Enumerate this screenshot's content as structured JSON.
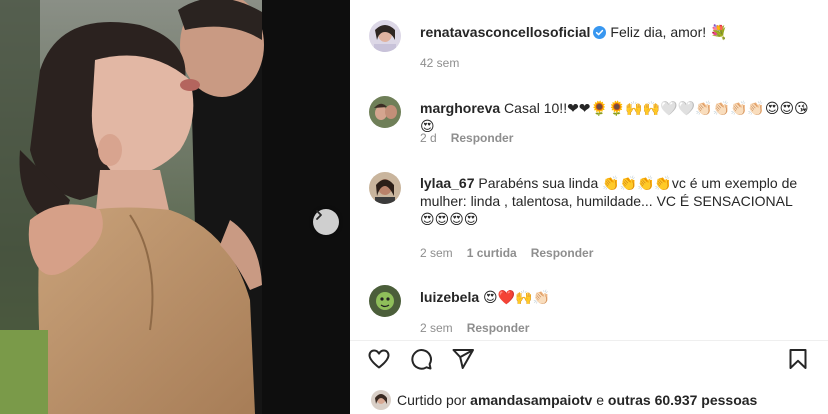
{
  "post": {
    "author": "renatavasconcellosoficial",
    "caption": "Feliz dia, amor! 💐",
    "time": "42 sem"
  },
  "comments": [
    {
      "user": "marghoreva",
      "text": "Casal 10!!❤❤🌻🌻🙌🙌🤍🤍👏🏻👏🏻👏🏻👏🏻😍😍😘😍",
      "time": "2 d",
      "reply": "Responder"
    },
    {
      "user": "lylaa_67",
      "text_line1": "Parabéns sua linda 👏👏👏👏vc é um exemplo de",
      "text_line2": "mulher: linda , talentosa, humildade... VC É SENSACIONAL",
      "text_line3": "😍😍😍😍",
      "time": "2 sem",
      "likes": "1 curtida",
      "reply": "Responder"
    },
    {
      "user": "luizebela",
      "text": "😍❤️🙌👏🏻",
      "time": "2 sem",
      "reply": "Responder"
    }
  ],
  "footer": {
    "liked_prefix": "Curtido por",
    "liked_user": "amandasampaiotv",
    "liked_middle": "e",
    "liked_others": "outras 60.937 pessoas"
  },
  "icons": {
    "like": "heart-icon",
    "comment": "comment-icon",
    "share": "paper-plane-icon",
    "save": "bookmark-icon",
    "next": "chevron-right-icon",
    "verified": "verified-badge-icon"
  },
  "colors": {
    "verified": "#3897f0",
    "text": "#262626",
    "muted": "#8e8e8e"
  }
}
